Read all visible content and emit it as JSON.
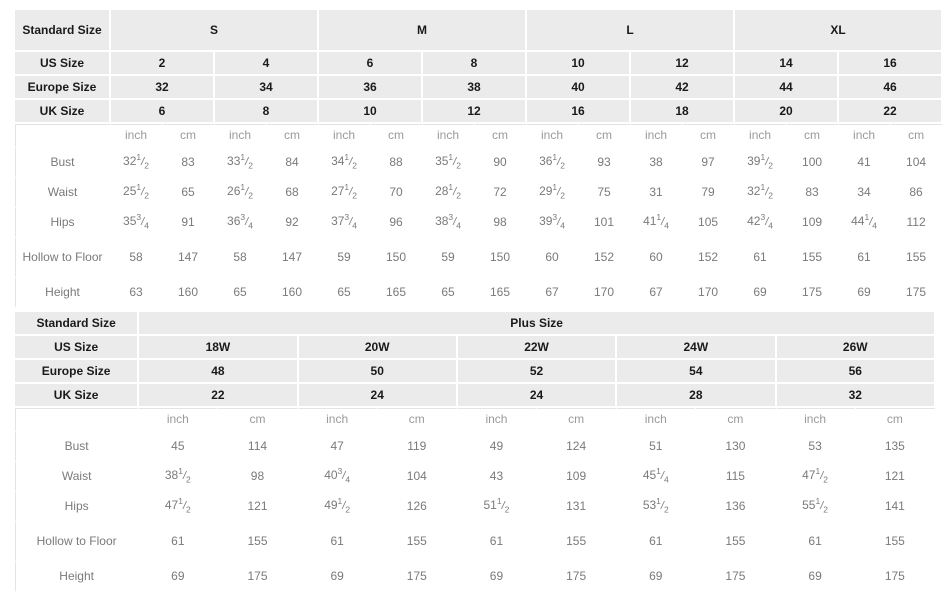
{
  "standard_table": {
    "corner_label": "Standard Size",
    "groups": [
      {
        "label": "S",
        "span": 4
      },
      {
        "label": "M",
        "span": 4
      },
      {
        "label": "L",
        "span": 4
      },
      {
        "label": "XL",
        "span": 4
      }
    ],
    "header_rows": [
      {
        "label": "US Size",
        "values": [
          "2",
          "4",
          "6",
          "8",
          "10",
          "12",
          "14",
          "16"
        ]
      },
      {
        "label": "Europe Size",
        "values": [
          "32",
          "34",
          "36",
          "38",
          "40",
          "42",
          "44",
          "46"
        ]
      },
      {
        "label": "UK Size",
        "values": [
          "6",
          "8",
          "10",
          "12",
          "16",
          "18",
          "20",
          "22"
        ]
      }
    ],
    "units": [
      "inch",
      "cm",
      "inch",
      "cm",
      "inch",
      "cm",
      "inch",
      "cm",
      "inch",
      "cm",
      "inch",
      "cm",
      "inch",
      "cm",
      "inch",
      "cm"
    ],
    "measurements": [
      {
        "label": "Bust",
        "values": [
          {
            "whole": "32",
            "num": "1",
            "den": "2"
          },
          {
            "whole": "83"
          },
          {
            "whole": "33",
            "num": "1",
            "den": "2"
          },
          {
            "whole": "84"
          },
          {
            "whole": "34",
            "num": "1",
            "den": "2"
          },
          {
            "whole": "88"
          },
          {
            "whole": "35",
            "num": "1",
            "den": "2"
          },
          {
            "whole": "90"
          },
          {
            "whole": "36",
            "num": "1",
            "den": "2"
          },
          {
            "whole": "93"
          },
          {
            "whole": "38"
          },
          {
            "whole": "97"
          },
          {
            "whole": "39",
            "num": "1",
            "den": "2"
          },
          {
            "whole": "100"
          },
          {
            "whole": "41"
          },
          {
            "whole": "104"
          }
        ]
      },
      {
        "label": "Waist",
        "values": [
          {
            "whole": "25",
            "num": "1",
            "den": "2"
          },
          {
            "whole": "65"
          },
          {
            "whole": "26",
            "num": "1",
            "den": "2"
          },
          {
            "whole": "68"
          },
          {
            "whole": "27",
            "num": "1",
            "den": "2"
          },
          {
            "whole": "70"
          },
          {
            "whole": "28",
            "num": "1",
            "den": "2"
          },
          {
            "whole": "72"
          },
          {
            "whole": "29",
            "num": "1",
            "den": "2"
          },
          {
            "whole": "75"
          },
          {
            "whole": "31"
          },
          {
            "whole": "79"
          },
          {
            "whole": "32",
            "num": "1",
            "den": "2"
          },
          {
            "whole": "83"
          },
          {
            "whole": "34"
          },
          {
            "whole": "86"
          }
        ]
      },
      {
        "label": "Hips",
        "values": [
          {
            "whole": "35",
            "num": "3",
            "den": "4"
          },
          {
            "whole": "91"
          },
          {
            "whole": "36",
            "num": "3",
            "den": "4"
          },
          {
            "whole": "92"
          },
          {
            "whole": "37",
            "num": "3",
            "den": "4"
          },
          {
            "whole": "96"
          },
          {
            "whole": "38",
            "num": "3",
            "den": "4"
          },
          {
            "whole": "98"
          },
          {
            "whole": "39",
            "num": "3",
            "den": "4"
          },
          {
            "whole": "101"
          },
          {
            "whole": "41",
            "num": "1",
            "den": "4"
          },
          {
            "whole": "105"
          },
          {
            "whole": "42",
            "num": "3",
            "den": "4"
          },
          {
            "whole": "109"
          },
          {
            "whole": "44",
            "num": "1",
            "den": "4"
          },
          {
            "whole": "112"
          }
        ]
      },
      {
        "label": "Hollow to Floor",
        "values": [
          {
            "whole": "58"
          },
          {
            "whole": "147"
          },
          {
            "whole": "58"
          },
          {
            "whole": "147"
          },
          {
            "whole": "59"
          },
          {
            "whole": "150"
          },
          {
            "whole": "59"
          },
          {
            "whole": "150"
          },
          {
            "whole": "60"
          },
          {
            "whole": "152"
          },
          {
            "whole": "60"
          },
          {
            "whole": "152"
          },
          {
            "whole": "61"
          },
          {
            "whole": "155"
          },
          {
            "whole": "61"
          },
          {
            "whole": "155"
          }
        ]
      },
      {
        "label": "Height",
        "values": [
          {
            "whole": "63"
          },
          {
            "whole": "160"
          },
          {
            "whole": "65"
          },
          {
            "whole": "160"
          },
          {
            "whole": "65"
          },
          {
            "whole": "165"
          },
          {
            "whole": "65"
          },
          {
            "whole": "165"
          },
          {
            "whole": "67"
          },
          {
            "whole": "170"
          },
          {
            "whole": "67"
          },
          {
            "whole": "170"
          },
          {
            "whole": "69"
          },
          {
            "whole": "175"
          },
          {
            "whole": "69"
          },
          {
            "whole": "175"
          }
        ]
      }
    ]
  },
  "plus_table": {
    "corner_label": "Standard Size",
    "group_label": "Plus Size",
    "header_rows": [
      {
        "label": "US Size",
        "values": [
          "18W",
          "20W",
          "22W",
          "24W",
          "26W"
        ]
      },
      {
        "label": "Europe Size",
        "values": [
          "48",
          "50",
          "52",
          "54",
          "56"
        ]
      },
      {
        "label": "UK Size",
        "values": [
          "22",
          "24",
          "24",
          "28",
          "32"
        ]
      }
    ],
    "units": [
      "inch",
      "cm",
      "inch",
      "cm",
      "inch",
      "cm",
      "inch",
      "cm",
      "inch",
      "cm"
    ],
    "measurements": [
      {
        "label": "Bust",
        "values": [
          {
            "whole": "45"
          },
          {
            "whole": "114"
          },
          {
            "whole": "47"
          },
          {
            "whole": "119"
          },
          {
            "whole": "49"
          },
          {
            "whole": "124"
          },
          {
            "whole": "51"
          },
          {
            "whole": "130"
          },
          {
            "whole": "53"
          },
          {
            "whole": "135"
          }
        ]
      },
      {
        "label": "Waist",
        "values": [
          {
            "whole": "38",
            "num": "1",
            "den": "2"
          },
          {
            "whole": "98"
          },
          {
            "whole": "40",
            "num": "3",
            "den": "4"
          },
          {
            "whole": "104"
          },
          {
            "whole": "43"
          },
          {
            "whole": "109"
          },
          {
            "whole": "45",
            "num": "1",
            "den": "4"
          },
          {
            "whole": "115"
          },
          {
            "whole": "47",
            "num": "1",
            "den": "2"
          },
          {
            "whole": "121"
          }
        ]
      },
      {
        "label": "Hips",
        "values": [
          {
            "whole": "47",
            "num": "1",
            "den": "2"
          },
          {
            "whole": "121"
          },
          {
            "whole": "49",
            "num": "1",
            "den": "2"
          },
          {
            "whole": "126"
          },
          {
            "whole": "51",
            "num": "1",
            "den": "2"
          },
          {
            "whole": "131"
          },
          {
            "whole": "53",
            "num": "1",
            "den": "2"
          },
          {
            "whole": "136"
          },
          {
            "whole": "55",
            "num": "1",
            "den": "2"
          },
          {
            "whole": "141"
          }
        ]
      },
      {
        "label": "Hollow to Floor",
        "values": [
          {
            "whole": "61"
          },
          {
            "whole": "155"
          },
          {
            "whole": "61"
          },
          {
            "whole": "155"
          },
          {
            "whole": "61"
          },
          {
            "whole": "155"
          },
          {
            "whole": "61"
          },
          {
            "whole": "155"
          },
          {
            "whole": "61"
          },
          {
            "whole": "155"
          }
        ]
      },
      {
        "label": "Height",
        "values": [
          {
            "whole": "69"
          },
          {
            "whole": "175"
          },
          {
            "whole": "69"
          },
          {
            "whole": "175"
          },
          {
            "whole": "69"
          },
          {
            "whole": "175"
          },
          {
            "whole": "69"
          },
          {
            "whole": "175"
          },
          {
            "whole": "69"
          },
          {
            "whole": "175"
          }
        ]
      }
    ]
  },
  "colors": {
    "header_bg": "#ebebeb",
    "header_text": "#1a1a1a",
    "body_text": "#7a7a7a",
    "unit_text": "#9a9a9a",
    "grid_line": "#e3e3e3",
    "page_bg": "#ffffff"
  }
}
